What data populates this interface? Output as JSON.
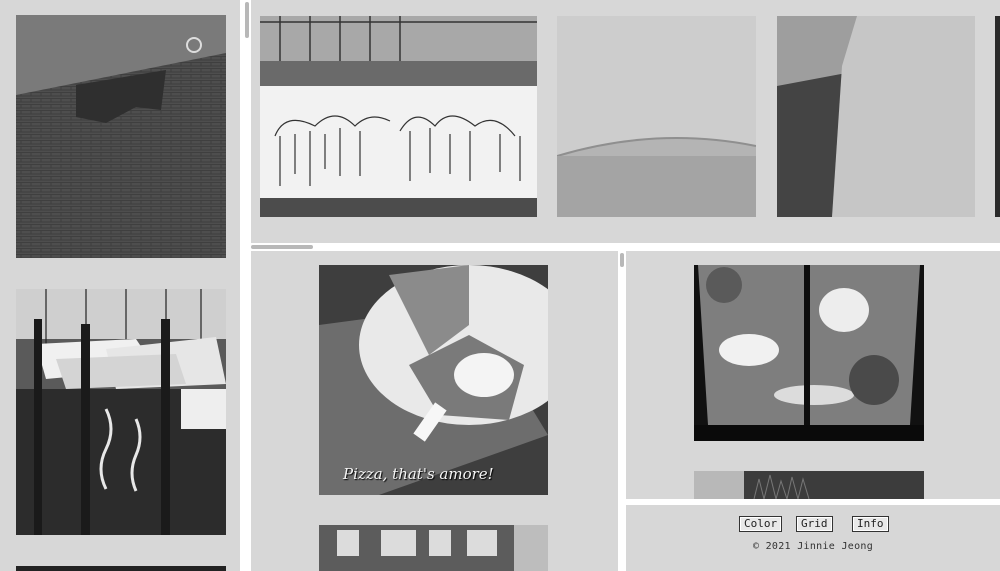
{
  "photos": {
    "wall": "brick-building-wall-photo",
    "marina": "marina-boats-reflection-photo",
    "graffiti": "graffiti-wall-photo",
    "curtain": "linen-curtain-photo",
    "shadow_wall": "wall-shadow-photo",
    "pizza": "pizza-plate-photo",
    "window": "skylight-window-photo",
    "grass": "grass-strip-photo",
    "building": "brick-apartment-photo"
  },
  "pizza_caption": "Pizza, that's amore!",
  "nav": {
    "color_label": "Color",
    "grid_label": "Grid",
    "info_label": "Info"
  },
  "footer": {
    "copyright": "© 2021 Jinnie Jeong"
  }
}
